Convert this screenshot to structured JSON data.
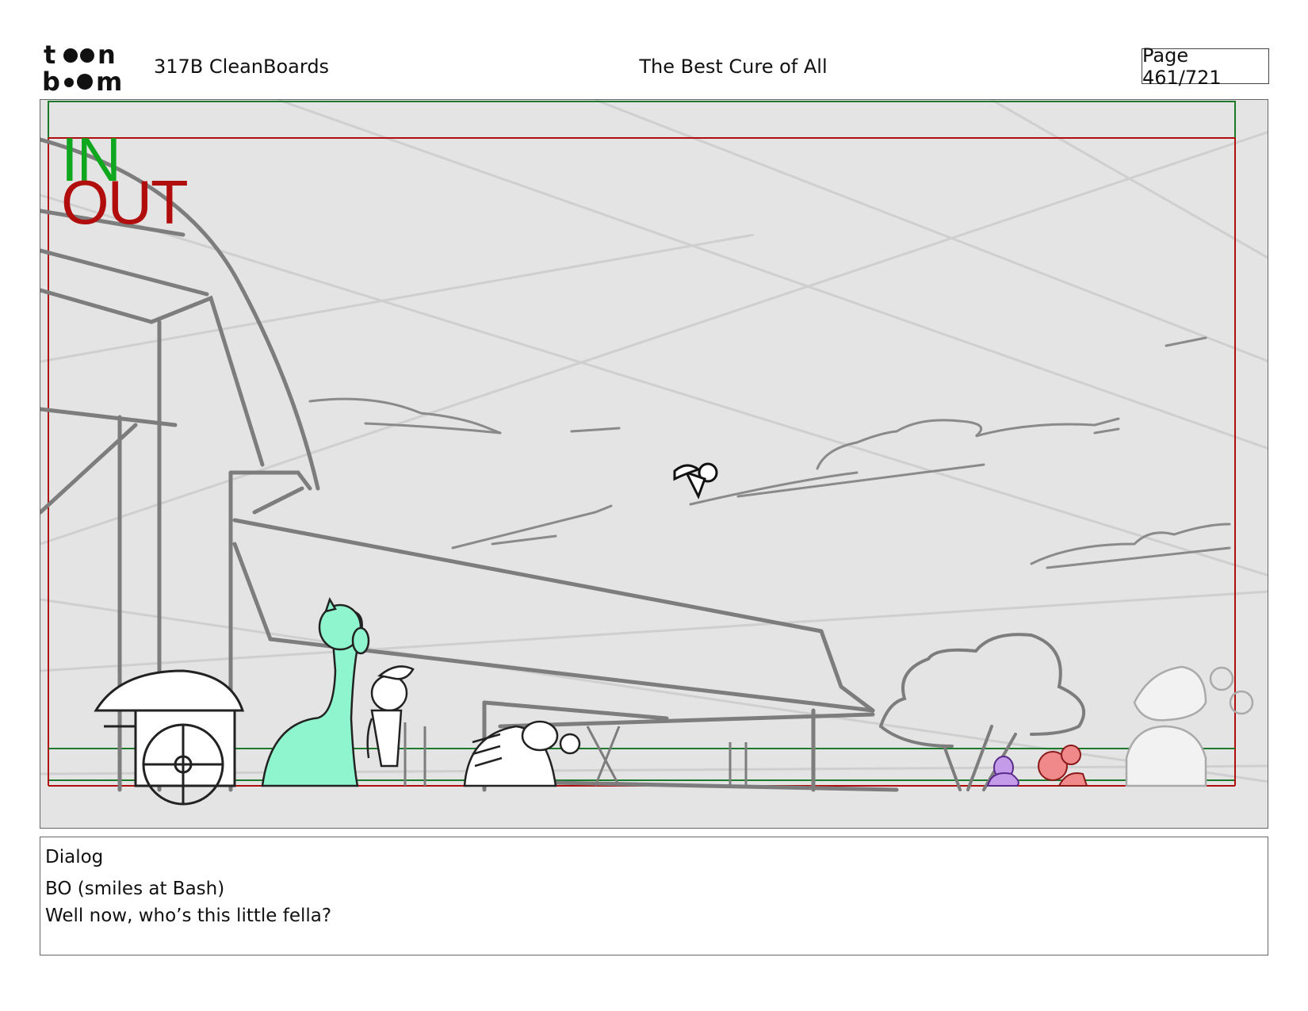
{
  "header": {
    "logo": {
      "icon": "toonboom-logo",
      "text_top": "toon",
      "text_bottom": "boom"
    },
    "episode": "317B  CleanBoards",
    "title": "The Best Cure of All",
    "page": "Page 461/721"
  },
  "panel": {
    "in_label": "IN",
    "out_label": "OUT",
    "colors": {
      "in": "#0fa71e",
      "out": "#b10d0d",
      "background": "#e4e4e4",
      "sketch": "#7d7d7d",
      "horse_mint": "#8ef5cf",
      "pony_purple": "#9b4fd6",
      "pony_red": "#e85a5a"
    }
  },
  "dialog": {
    "heading": "Dialog",
    "lines": [
      "BO (smiles at Bash)",
      "Well now, who’s this little fella?"
    ]
  }
}
